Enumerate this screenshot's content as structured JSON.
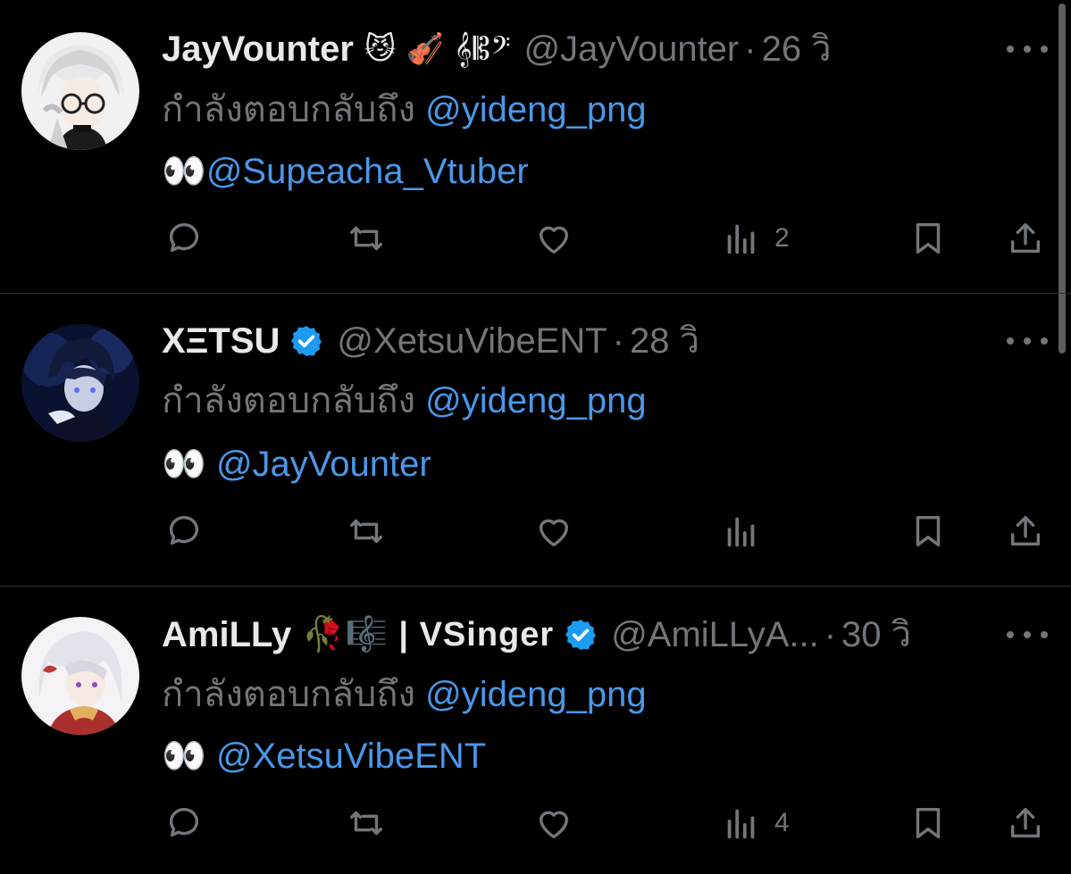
{
  "tweets": [
    {
      "display_name": "JayVounter",
      "name_extra": "😼 🎻 𝄞𝄡𝄢",
      "verified": false,
      "handle": "@JayVounter",
      "separator": "·",
      "time": "26 วิ",
      "reply_prefix": "กำลังตอบกลับถึง",
      "reply_to": "@yideng_png",
      "body_emoji": "👀",
      "body_mention": "@Supeacha_Vtuber",
      "views": "2"
    },
    {
      "display_name": "XΞTSU",
      "name_extra": "",
      "verified": true,
      "handle": "@XetsuVibeENT",
      "separator": "·",
      "time": "28 วิ",
      "reply_prefix": "กำลังตอบกลับถึง",
      "reply_to": "@yideng_png",
      "body_emoji": "👀",
      "body_mention": "@JayVounter",
      "views": ""
    },
    {
      "display_name": "AmiLLy",
      "name_extra": "🥀🎼 | VSinger",
      "verified": true,
      "handle": "@AmiLLyA...",
      "separator": "·",
      "time": "30 วิ",
      "reply_prefix": "กำลังตอบกลับถึง",
      "reply_to": "@yideng_png",
      "body_emoji": "👀",
      "body_mention": "@XetsuVibeENT",
      "views": "4"
    }
  ],
  "icons": {
    "reply": "reply-icon",
    "retweet": "retweet-icon",
    "like": "like-icon",
    "views": "views-icon",
    "bookmark": "bookmark-icon",
    "share": "share-icon",
    "more": "more-icon",
    "verified": "verified-badge-icon"
  },
  "colors": {
    "background": "#000000",
    "text": "#e7e9ea",
    "secondary": "#71767b",
    "link": "#4a97e8",
    "verified": "#1d9bf0",
    "divider": "#2f3336"
  }
}
